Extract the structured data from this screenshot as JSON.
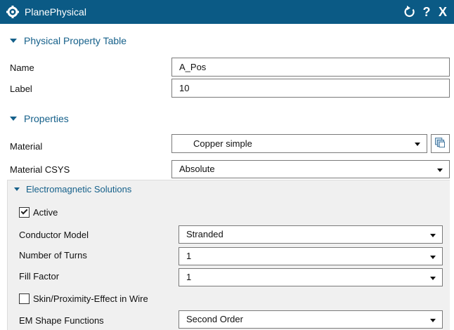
{
  "window": {
    "title": "PlanePhysical",
    "reset_icon": "reset-icon",
    "help_label": "?",
    "close_label": "X"
  },
  "physical_property_table": {
    "header": "Physical Property Table",
    "name_label": "Name",
    "name_value": "A_Pos",
    "label_label": "Label",
    "label_value": "10"
  },
  "properties": {
    "header": "Properties",
    "material_label": "Material",
    "material_value": "Copper simple",
    "material_csys_label": "Material CSYS",
    "material_csys_value": "Absolute"
  },
  "electromagnetic_solutions": {
    "header": "Electromagnetic Solutions",
    "active_label": "Active",
    "active_checked": true,
    "conductor_model_label": "Conductor Model",
    "conductor_model_value": "Stranded",
    "number_of_turns_label": "Number of Turns",
    "number_of_turns_value": "1",
    "fill_factor_label": "Fill Factor",
    "fill_factor_value": "1",
    "skin_effect_label": "Skin/Proximity-Effect in Wire",
    "skin_effect_checked": false,
    "em_shape_functions_label": "EM Shape Functions",
    "em_shape_functions_value": "Second Order"
  },
  "colors": {
    "titlebar": "#0b5a85",
    "section_header": "#15608a",
    "panel_bg": "#f0f0f0"
  }
}
